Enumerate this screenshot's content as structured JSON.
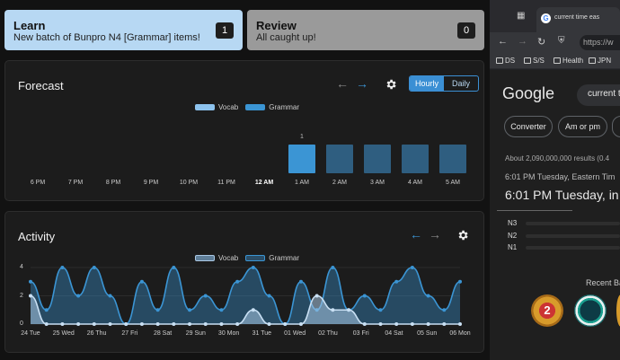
{
  "learn": {
    "title": "Learn",
    "subtitle": "New batch of Bunpro N4 [Grammar] items!",
    "count": "1"
  },
  "review": {
    "title": "Review",
    "subtitle": "All caught up!",
    "count": "0"
  },
  "forecast": {
    "title": "Forecast",
    "toggle": {
      "hourly": "Hourly",
      "daily": "Daily",
      "selected": "Hourly"
    },
    "legend": {
      "vocab": "Vocab",
      "grammar": "Grammar"
    },
    "colors": {
      "vocab": "#8dc3ee",
      "grammar": "#3b95d4",
      "bar": "#2f5e80"
    }
  },
  "activity": {
    "title": "Activity",
    "legend": {
      "vocab": "Vocab",
      "grammar": "Grammar"
    },
    "y_ticks": [
      "4",
      "2",
      "0"
    ]
  },
  "chart_data": [
    {
      "type": "bar",
      "categories": [
        "6 PM",
        "7 PM",
        "8 PM",
        "9 PM",
        "10 PM",
        "11 PM",
        "12 AM",
        "1 AM",
        "2 AM",
        "3 AM",
        "4 AM",
        "5 AM"
      ],
      "highlight_category": "12 AM",
      "series": [
        {
          "name": "Vocab",
          "values": [
            0,
            0,
            0,
            0,
            0,
            0,
            0,
            0,
            0,
            0,
            0,
            0
          ]
        },
        {
          "name": "Grammar",
          "values": [
            0,
            0,
            0,
            0,
            0,
            0,
            0,
            1,
            1,
            1,
            1,
            1
          ]
        }
      ],
      "data_labels": {
        "1 AM": "1"
      },
      "ylim": [
        0,
        1
      ]
    },
    {
      "type": "area",
      "categories": [
        "24 Tue",
        "25 Wed",
        "26 Thu",
        "27 Fri",
        "28 Sat",
        "29 Sun",
        "30 Mon",
        "31 Tue",
        "01 Wed",
        "02 Thu",
        "03 Fri",
        "04 Sat",
        "05 Sun",
        "06 Mon"
      ],
      "x_points": [
        0,
        1,
        2,
        3,
        4,
        5,
        6,
        7,
        8,
        9,
        10,
        11,
        12,
        13,
        14,
        15,
        16,
        17,
        18,
        19,
        20,
        21,
        22,
        23,
        24,
        25,
        26,
        27
      ],
      "series": [
        {
          "name": "Vocab",
          "values": [
            2,
            0,
            0,
            0,
            0,
            0,
            0,
            0,
            0,
            0,
            0,
            0,
            0,
            0,
            1,
            0,
            0,
            0,
            2,
            1,
            1,
            0,
            0,
            0,
            0,
            0,
            0,
            0
          ]
        },
        {
          "name": "Grammar",
          "values": [
            3,
            1,
            4,
            2,
            4,
            2,
            0,
            3,
            1,
            4,
            1,
            2,
            1,
            3,
            4,
            2,
            0,
            3,
            1,
            4,
            1,
            2,
            1,
            3,
            4,
            2,
            1,
            3
          ]
        }
      ],
      "ylim": [
        0,
        4
      ]
    }
  ],
  "browser": {
    "tab_title": "current time eas",
    "url": "https://w",
    "bookmarks": [
      "DS",
      "S/S",
      "Health",
      "JPN"
    ],
    "search_query": "current t",
    "chips": [
      "Converter",
      "Am or pm"
    ],
    "results_count": "About 2,090,000,000 results (0.4",
    "time_small": "6:01 PM Tuesday, Eastern Tim",
    "time_large": "6:01 PM Tuesday, in",
    "levels": [
      "N3",
      "N2",
      "N1"
    ],
    "recent_badges": "Recent Ba",
    "badge_text": "2",
    "google_logo": "Google"
  }
}
